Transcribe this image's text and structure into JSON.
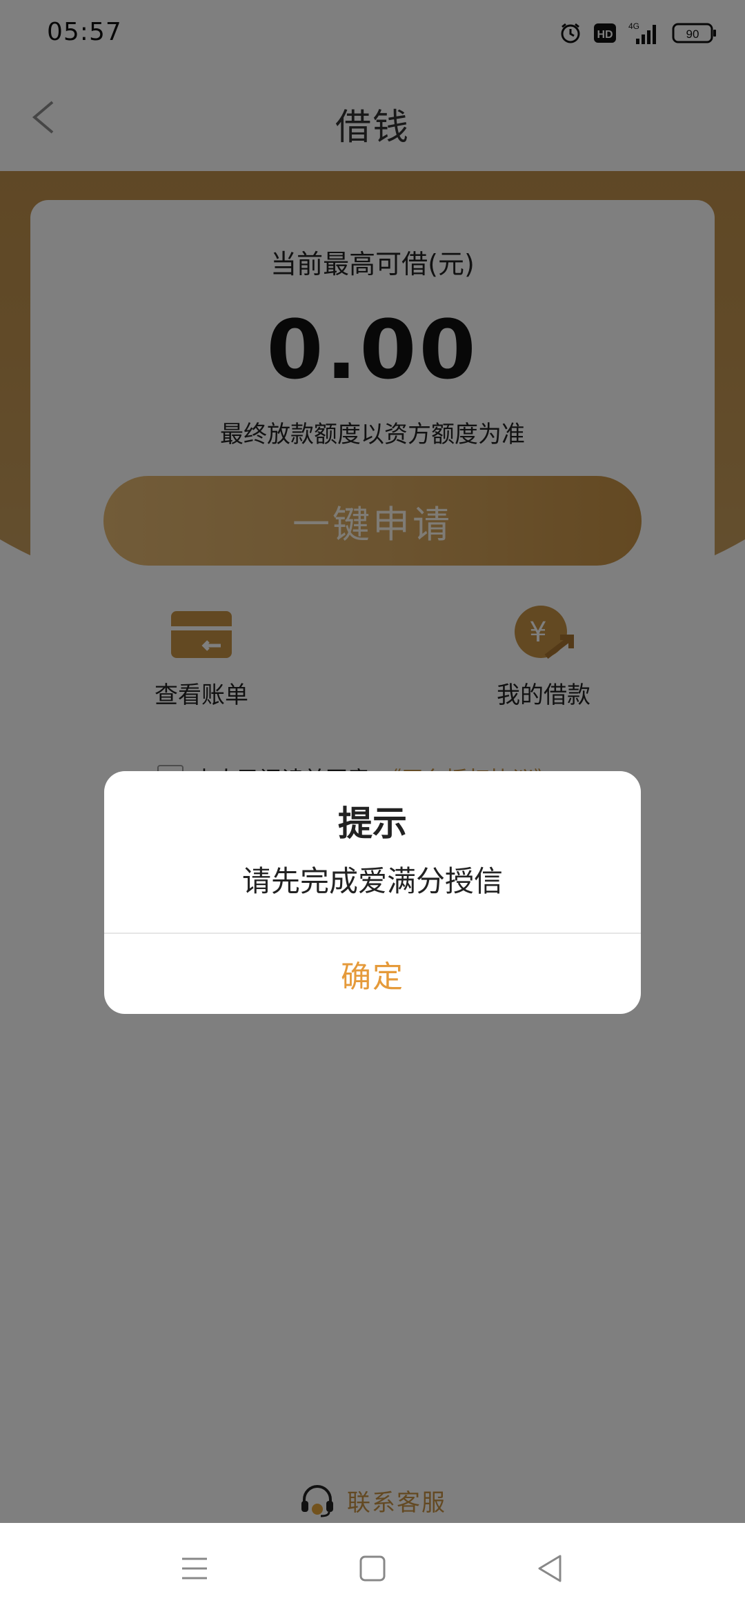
{
  "status_bar": {
    "time": "05:57",
    "icons": [
      "alarm-icon",
      "hd-icon",
      "signal-4g-icon",
      "battery-icon"
    ],
    "network": "4G",
    "hd_label": "HD",
    "battery": "90"
  },
  "header": {
    "title": "借钱",
    "back_icon": "chevron-left-icon"
  },
  "card": {
    "label": "当前最高可借(元)",
    "amount": "0.00",
    "note": "最终放款额度以资方额度为准",
    "apply_button": "一键申请",
    "shortcuts": [
      {
        "label": "查看账单",
        "icon": "bill-card-icon"
      },
      {
        "label": "我的借款",
        "icon": "yuan-coin-icon"
      }
    ],
    "agreement_text": "本人已阅读并同意",
    "agreement_link": "《平台授权协议》"
  },
  "footer": {
    "customer_service": "联系客服",
    "icon": "headset-icon"
  },
  "dialog": {
    "title": "提示",
    "message": "请先完成爱满分授信",
    "confirm": "确定"
  },
  "system_nav": {
    "icons": [
      "menu-icon",
      "home-icon",
      "back-triangle-icon"
    ]
  },
  "colors": {
    "brand_gold": "#c79245",
    "header_band": "#ba8b45",
    "confirm_text": "#e59a3a",
    "overlay": "rgba(0,0,0,0.5)"
  }
}
